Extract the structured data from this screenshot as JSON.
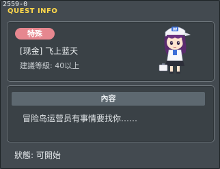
{
  "window": {
    "quest_id": "2559-0",
    "title": "QUEST INFO"
  },
  "quest": {
    "category_badge": "特殊",
    "name": "[现金] 飞上蓝天",
    "recommended_level": "建議等級: 40以上"
  },
  "content_section": {
    "header": "內容",
    "description": "冒险岛运营员有事情要找你……"
  },
  "status": {
    "text": "狀態: 可開始"
  },
  "colors": {
    "title": "#ffd84a",
    "badge": "#e6878f",
    "panel_bg": "#3a4146",
    "header_bg": "#5d6870"
  },
  "icons": {
    "npc_portrait": "maplestory-operator-character"
  }
}
